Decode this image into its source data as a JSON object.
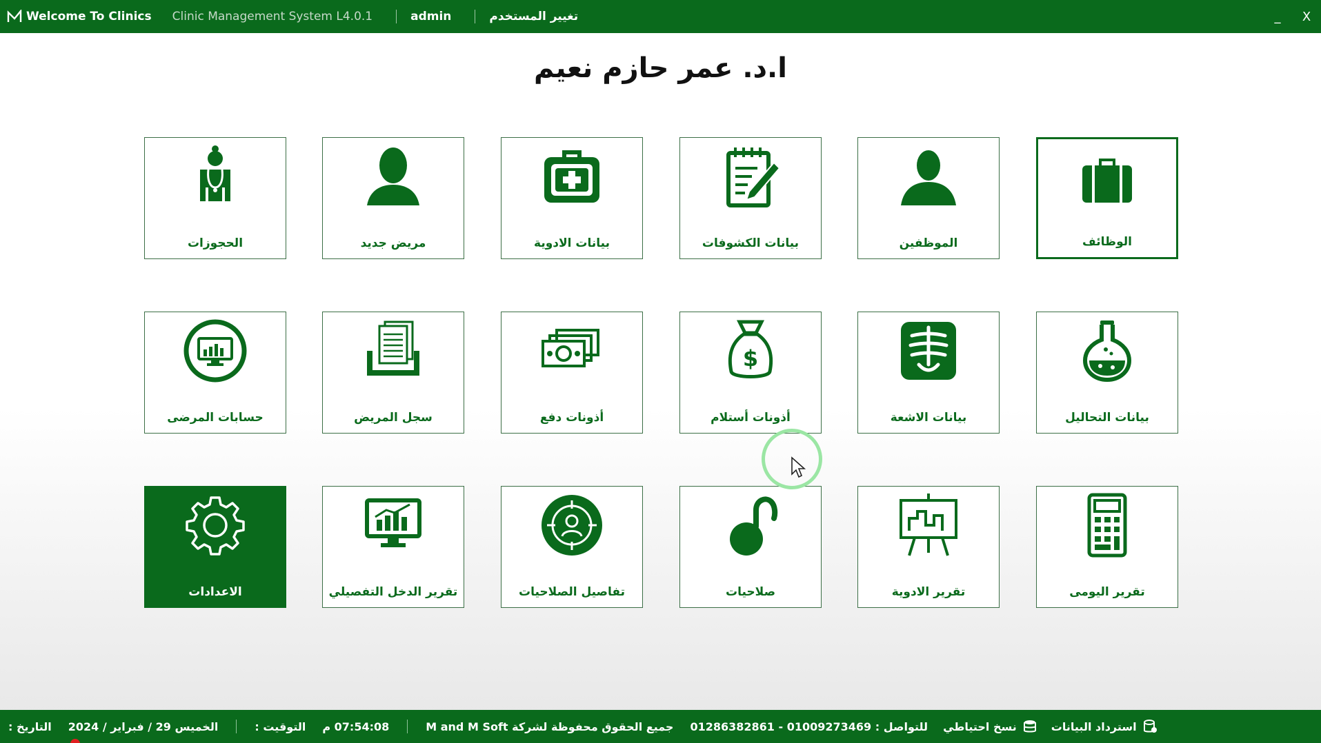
{
  "titlebar": {
    "app_title": "Welcome To Clinics",
    "version": "Clinic Management System L4.0.1",
    "user": "admin",
    "switch_user": "تغيير المستخدم",
    "minimize": "_",
    "close": "X"
  },
  "doctor_name": "ا.د. عمر حازم نعيم",
  "tiles": {
    "jobs": "الوظائف",
    "employees": "الموظفين",
    "exams": "بيانات الكشوفات",
    "medicines": "بيانات الادوية",
    "new_patient": "مريض جديد",
    "bookings": "الحجوزات",
    "lab_tests": "بيانات التحاليل",
    "xray": "بيانات الاشعة",
    "receipts": "أذونات أستلام",
    "payments": "أذونات دفع",
    "patient_record": "سجل المريض",
    "patient_accounts": "حسابات المرضى",
    "daily_report": "تقرير اليومى",
    "medicine_report": "تقرير الادوية",
    "permissions": "صلاحيات",
    "permission_details": "تفاصيل الصلاحيات",
    "income_report": "تقرير الدخل التفصيلي",
    "settings": "الاعدادات"
  },
  "statusbar": {
    "date_label": "التاريخ :",
    "date_value": "الخميس 29 / فبراير / 2024",
    "time_label": "التوقيت :",
    "time_value": "07:54:08 م",
    "rights": "جميع الحقوق محفوظة لشركة M and M Soft",
    "contact": "للتواصل : 01009273469 - 01286382861",
    "backup": "نسخ احتياطي",
    "restore": "استرداد البيانات"
  },
  "colors": {
    "primary": "#0a6a1c",
    "ring": "#9be6a4"
  }
}
